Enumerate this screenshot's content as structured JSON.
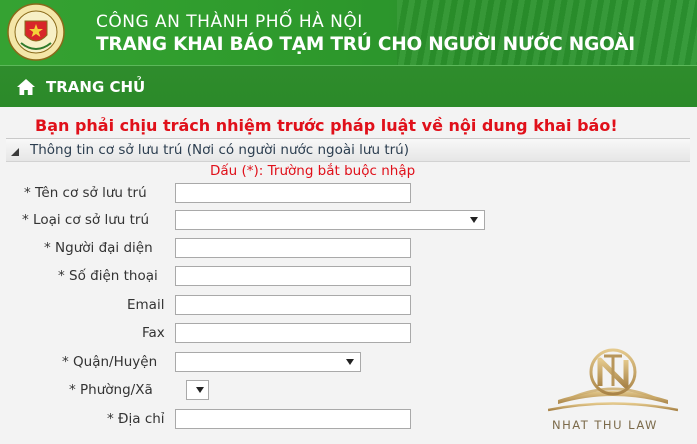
{
  "header": {
    "line1": "CÔNG AN THÀNH PHỐ HÀ NỘI",
    "line2": "TRANG KHAI BÁO TẠM TRÚ CHO NGƯỜI NƯỚC NGOÀI",
    "emblem_icon": "police-emblem-icon"
  },
  "nav": {
    "home_label": "TRANG CHỦ",
    "home_icon": "home-icon"
  },
  "warning": "Bạn phải chịu trách nhiệm trước pháp luật về nội dung khai báo!",
  "section": {
    "title": "Thông tin cơ sở lưu trú (Nơi có người nước ngoài lưu trú)",
    "note": "Dấu (*): Trường bắt buộc nhập"
  },
  "fields": {
    "ten_co_so": {
      "label": "* Tên cơ sở lưu trú",
      "value": ""
    },
    "loai_co_so": {
      "label": "* Loại cơ sở lưu trú",
      "value": ""
    },
    "nguoi_dai_dien": {
      "label": "* Người đại diện",
      "value": ""
    },
    "so_dien_thoai": {
      "label": "* Số điện thoại",
      "value": ""
    },
    "email": {
      "label": "Email",
      "value": ""
    },
    "fax": {
      "label": "Fax",
      "value": ""
    },
    "quan_huyen": {
      "label": "* Quận/Huyện",
      "value": ""
    },
    "phuong_xa": {
      "label": "* Phường/Xã",
      "value": ""
    },
    "dia_chi": {
      "label": "* Địa chỉ",
      "value": ""
    }
  },
  "watermark": {
    "text": "NHAT THU LAW"
  },
  "colors": {
    "header_green": "#2f9c2d",
    "nav_green": "#2b8a29",
    "warning_red": "#e0101a",
    "watermark_gold": "#b8965a"
  }
}
